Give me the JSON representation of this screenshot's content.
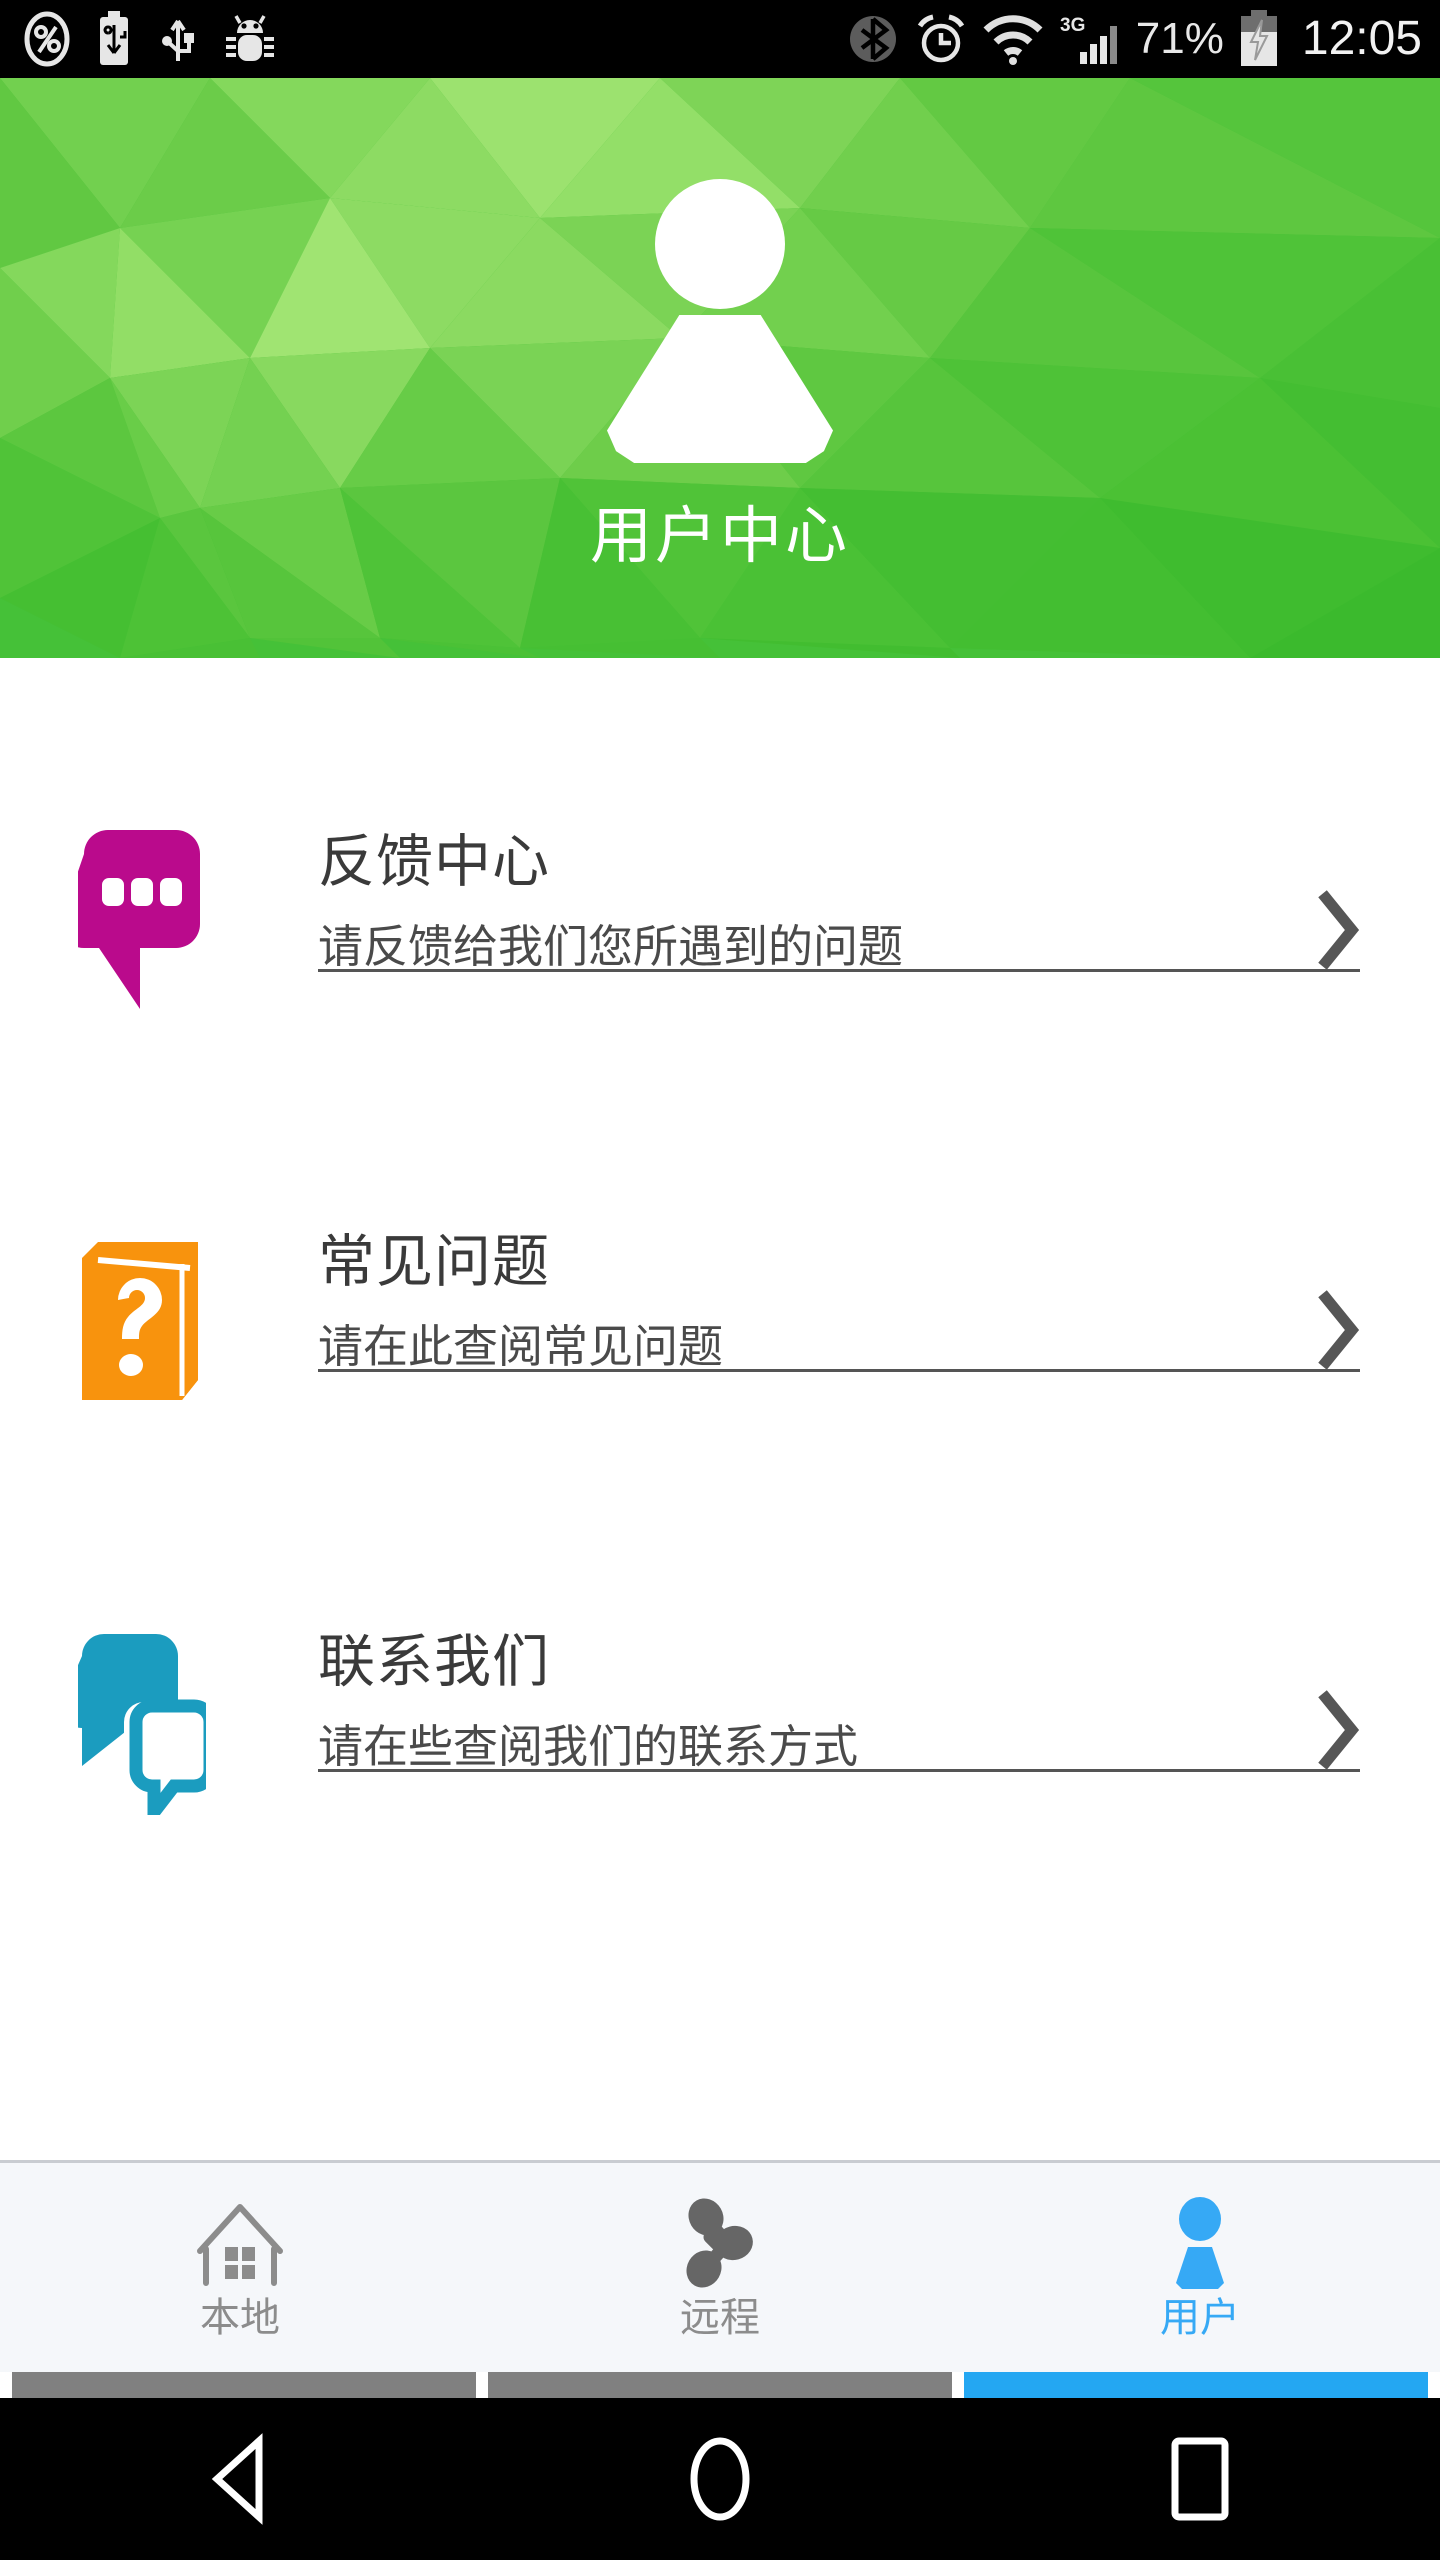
{
  "status_bar": {
    "left_icons": [
      "percent-circle-icon",
      "usb-battery-icon",
      "usb-icon",
      "android-debug-icon"
    ],
    "right_icons": [
      "bluetooth-icon",
      "alarm-icon",
      "wifi-icon",
      "cellular-signal-icon"
    ],
    "network_type": "3G",
    "battery_percent": "71%",
    "battery_state": "charging",
    "time": "12:05"
  },
  "header": {
    "title": "用户中心",
    "avatar_icon": "user-avatar-icon",
    "background_color": "#45C138",
    "background_style": "low-poly-triangles"
  },
  "list": {
    "items": [
      {
        "icon": "speech-bubble-dots-icon",
        "icon_color": "#BA0A8C",
        "title": "反馈中心",
        "subtitle": "请反馈给我们您所遇到的问题",
        "chevron": "chevron-right-icon"
      },
      {
        "icon": "book-question-icon",
        "icon_color": "#F8930D",
        "title": "常见问题",
        "subtitle": "请在此查阅常见问题",
        "chevron": "chevron-right-icon"
      },
      {
        "icon": "double-speech-bubble-icon",
        "icon_color": "#1B9CBF",
        "title": "联系我们",
        "subtitle": "请在些查阅我们的联系方式",
        "chevron": "chevron-right-icon"
      }
    ]
  },
  "tab_bar": {
    "active_index": 2,
    "active_color": "#36A9F5",
    "inactive_color": "#8C8C8C",
    "tabs": [
      {
        "icon": "home-icon",
        "label": "本地"
      },
      {
        "icon": "network-nodes-icon",
        "label": "远程"
      },
      {
        "icon": "person-icon",
        "label": "用户"
      }
    ]
  },
  "nav_bar": {
    "buttons": [
      {
        "icon": "back-triangle-icon"
      },
      {
        "icon": "home-circle-icon"
      },
      {
        "icon": "recents-square-icon"
      }
    ]
  }
}
